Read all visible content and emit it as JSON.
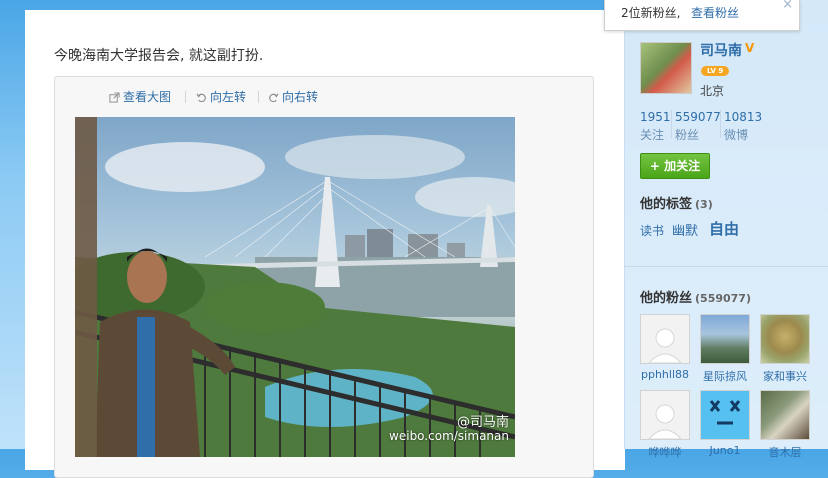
{
  "post": {
    "text": "今晚海南大学报告会, 就这副打扮."
  },
  "media_toolbar": {
    "view_large": "查看大图",
    "rotate_left": "向左转",
    "rotate_right": "向右转"
  },
  "photo": {
    "watermark_name": "@司马南",
    "watermark_url": "weibo.com/simanan"
  },
  "notification": {
    "text": "2位新粉丝,",
    "link": "查看粉丝",
    "close": "×"
  },
  "profile": {
    "name": "司马南",
    "verified_mark": "V",
    "level": "LV 9",
    "location": "北京",
    "stats": [
      {
        "value": "1951",
        "label": "关注"
      },
      {
        "value": "559077",
        "label": "粉丝"
      },
      {
        "value": "10813",
        "label": "微博"
      }
    ],
    "follow_button": "+ 加关注"
  },
  "tags": {
    "title": "他的标签",
    "count": "(3)",
    "items": [
      "读书",
      "幽默",
      "自由"
    ]
  },
  "fans": {
    "title": "他的粉丝",
    "count": "(559077)",
    "items": [
      {
        "name": "pphhll88"
      },
      {
        "name": "星际掠风"
      },
      {
        "name": "家和事兴"
      },
      {
        "name": "哗哗哗"
      },
      {
        "name": "Juno1"
      },
      {
        "name": "音木层"
      }
    ]
  },
  "colors": {
    "link": "#2f6ea8",
    "follow_green": "#4aa518",
    "verified_orange": "#f39800",
    "sky": "#4aa6e6"
  }
}
